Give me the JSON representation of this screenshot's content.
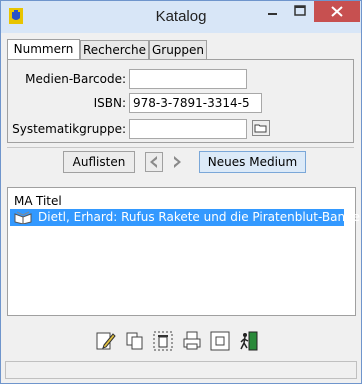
{
  "window": {
    "title": "Katalog"
  },
  "tabs": [
    {
      "label": "Nummern",
      "active": true
    },
    {
      "label": "Recherche",
      "active": false
    },
    {
      "label": "Gruppen",
      "active": false
    }
  ],
  "form": {
    "barcode_label": "Medien-Barcode:",
    "barcode_value": "",
    "isbn_label": "ISBN:",
    "isbn_value": "978-3-7891-3314-5",
    "group_label": "Systematikgruppe:",
    "group_value": ""
  },
  "actions": {
    "list_label": "Auflisten",
    "new_label": "Neues Medium"
  },
  "table": {
    "columns": [
      "MA",
      "Titel"
    ],
    "rows": [
      {
        "icon": "book-icon",
        "title": "Dietl, Erhard: Rufus Rakete und die Piratenblut-Bande",
        "selected": true
      }
    ]
  },
  "toolbar": [
    "edit-icon",
    "copy-icon",
    "delete-icon",
    "print-icon",
    "frame-icon",
    "exit-icon"
  ],
  "colors": {
    "accent": "#3399ff",
    "titlebar": "#d8e6f7",
    "close": "#c75050",
    "button_blue": "#dceaf8"
  }
}
